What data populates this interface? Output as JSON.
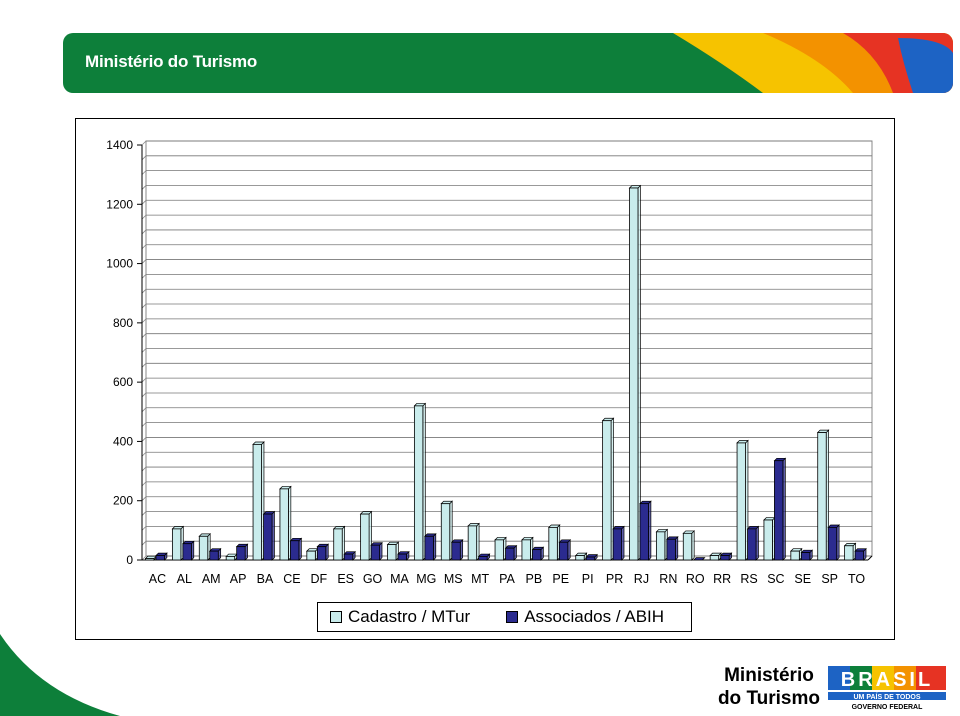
{
  "header": {
    "title": "Ministério do Turismo"
  },
  "footer": {
    "ministry_line1": "Ministério",
    "ministry_line2": "do Turismo",
    "logo_word": "BRASIL",
    "logo_tagline1": "UM PAÍS DE TODOS",
    "logo_tagline2": "GOVERNO FEDERAL"
  },
  "colors": {
    "banner_green": "#0d7f3a",
    "banner_yellow": "#f6c300",
    "banner_orange": "#f39200",
    "banner_red": "#e63323",
    "banner_blue": "#1d63c4",
    "series1": "#c9ecec",
    "series2": "#2b2b8f"
  },
  "chart_data": {
    "type": "bar",
    "title": "",
    "xlabel": "",
    "ylabel": "",
    "ylim": [
      0,
      1400
    ],
    "yticks": [
      "0",
      "200",
      "400",
      "600",
      "800",
      "1000",
      "1200",
      "1400"
    ],
    "grid": true,
    "legend_position": "bottom",
    "categories": [
      "AC",
      "AL",
      "AM",
      "AP",
      "BA",
      "CE",
      "DF",
      "ES",
      "GO",
      "MA",
      "MG",
      "MS",
      "MT",
      "PA",
      "PB",
      "PE",
      "PI",
      "PR",
      "RJ",
      "RN",
      "RO",
      "RR",
      "RS",
      "SC",
      "SE",
      "SP",
      "TO"
    ],
    "series": [
      {
        "name": "Cadastro / MTur",
        "color": "#c9ecec",
        "values": [
          5,
          105,
          80,
          12,
          390,
          240,
          30,
          105,
          155,
          52,
          520,
          190,
          115,
          68,
          68,
          110,
          15,
          470,
          1255,
          95,
          90,
          15,
          395,
          135,
          30,
          430,
          48
        ]
      },
      {
        "name": "Associados / ABIH",
        "color": "#2b2b8f",
        "values": [
          15,
          55,
          30,
          45,
          155,
          65,
          45,
          20,
          50,
          20,
          80,
          60,
          12,
          40,
          35,
          60,
          10,
          105,
          190,
          70,
          0,
          15,
          105,
          335,
          25,
          110,
          30
        ]
      }
    ]
  }
}
